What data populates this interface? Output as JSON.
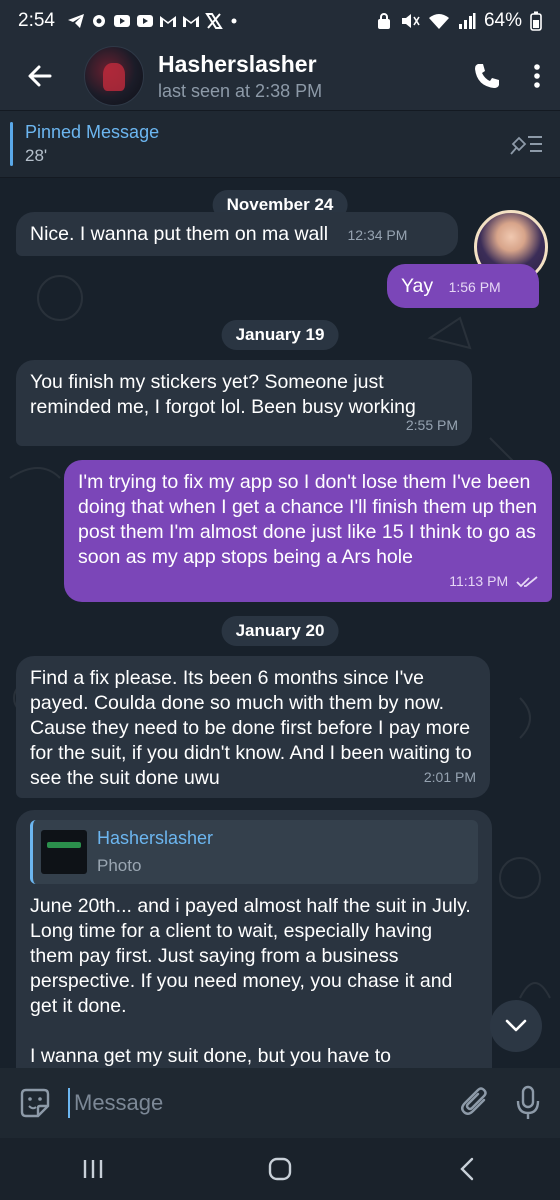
{
  "status_bar": {
    "time": "2:54",
    "battery": "64%"
  },
  "header": {
    "title": "Hasherslasher",
    "subtitle": "last seen at 2:38 PM"
  },
  "pinned": {
    "title": "Pinned Message",
    "text": "28'"
  },
  "messages": [
    {
      "type": "date",
      "text": "November 24"
    },
    {
      "type": "in",
      "text": "Nice. I wanna put them on ma wall",
      "time": "12:34 PM"
    },
    {
      "type": "out",
      "text": "Yay",
      "time": "1:56 PM"
    },
    {
      "type": "date",
      "text": "January 19"
    },
    {
      "type": "in",
      "text": "You finish my stickers yet? Someone just reminded me, I forgot lol. Been busy working",
      "time": "2:55 PM"
    },
    {
      "type": "out",
      "text": "I'm trying to fix my app so I don't lose them I've been doing that when I get a chance I'll finish them up then post them I'm almost done just like 15 I think to go as soon as my app stops being a Ars hole",
      "time": "11:13 PM"
    },
    {
      "type": "date",
      "text": "January 20"
    },
    {
      "type": "in",
      "text": "Find a fix please. Its been 6 months since I've payed. Coulda done so much with them by now. Cause they need to be done first before I pay more for the suit, if you didn't know. And I been waiting to see the suit done uwu",
      "time": "2:01 PM"
    },
    {
      "type": "in",
      "reply_name": "Hasherslasher",
      "reply_kind": "Photo",
      "text": "June 20th... and i payed almost half the suit in July. Long time for a client to wait, especially having them pay first. Just saying from a business perspective. If you need money, you chase it and get it done.",
      "text2": "I wanna get my suit done, but you have to"
    }
  ],
  "composer": {
    "placeholder": "Message"
  },
  "icons": {
    "back": "arrow-left-icon",
    "call": "phone-icon",
    "menu": "more-vertical-icon",
    "pin_list": "pin-list-icon",
    "emoji": "sticker-emoji-icon",
    "attach": "paperclip-icon",
    "mic": "microphone-icon",
    "scroll": "chevron-down-icon"
  },
  "colors": {
    "outgoing_bubble": "#7b46b8",
    "incoming_bubble": "#2a3440",
    "accent": "#6cb6f0",
    "background": "#18212b"
  }
}
